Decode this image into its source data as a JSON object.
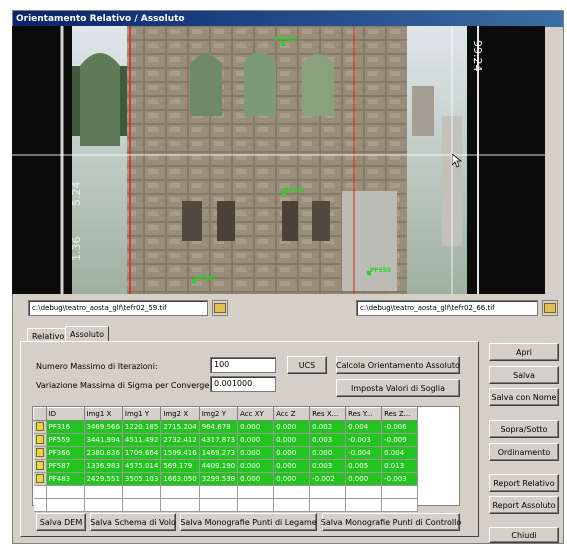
{
  "window": {
    "title": "Orientamento Relativo / Assoluto"
  },
  "view": {
    "left_scale": [
      "1.36",
      "5.24"
    ],
    "right_scale": "99.24",
    "points": [
      "PF483",
      "PF316",
      "PF587",
      "PF555"
    ]
  },
  "files": {
    "left_path": "c:\\debug\\teatro_aosta_glf\\tefr02_59.tif",
    "right_path": "c:\\debug\\teatro_aosta_glf\\tefr02_66.tif"
  },
  "tabs": [
    "Relativo",
    "Assoluto"
  ],
  "form": {
    "iter_label": "Numero Massimo di Iterazioni:",
    "iter_value": "100",
    "sigma_label": "Variazione Massima di Sigma per Convergenza:",
    "sigma_value": "0.001000",
    "ucs_button": "UCS",
    "calc_button": "Calcola Orientamento Assoluto",
    "threshold_button": "Imposta Valori di Soglia"
  },
  "table": {
    "headers": [
      "",
      "ID",
      "Img1 X",
      "Img1 Y",
      "Img2 X",
      "Img2 Y",
      "Acc XY",
      "Acc Z",
      "Res X...",
      "Res Y...",
      "Res Z..."
    ],
    "rows": [
      [
        "PF316",
        "3469.566",
        "1220.185",
        "2715.204",
        "964.678",
        "0.000",
        "0.000",
        "0.002",
        "0.004",
        "-0.006"
      ],
      [
        "PF559",
        "3441.994",
        "4511.492",
        "2732.412",
        "4317.873",
        "0.000",
        "0.000",
        "0.003",
        "-0.003",
        "-0.009"
      ],
      [
        "PF366",
        "2380.836",
        "1709.664",
        "1599.416",
        "1469.273",
        "0.000",
        "0.000",
        "0.000",
        "-0.004",
        "0.004"
      ],
      [
        "PF587",
        "1336.983",
        "4575.014",
        "569.179",
        "4409.190",
        "0.000",
        "0.000",
        "0.003",
        "0.005",
        "0.013"
      ],
      [
        "PF483",
        "2429.551",
        "3505.103",
        "1663.050",
        "3299.538",
        "0.000",
        "0.000",
        "-0.002",
        "0.000",
        "-0.003"
      ]
    ]
  },
  "bottom_buttons": [
    "Salva DEM",
    "Salva Schema di Volo",
    "Salva Monografie Punti di Legame",
    "Salva Monografie Punti di Controllo"
  ],
  "side_buttons": {
    "apri": "Apri",
    "salva": "Salva",
    "salva_nome": "Salva con Nome",
    "sopra_sotto": "Sopra/Sotto",
    "ordinamento": "Ordinamento",
    "report_relativo": "Report Relativo",
    "report_assoluto": "Report Assoluto",
    "chiudi": "Chiudi"
  },
  "colors": {
    "point_green": "#21d521",
    "row_green": "#23c41f",
    "title_blue": "#0a246a"
  }
}
